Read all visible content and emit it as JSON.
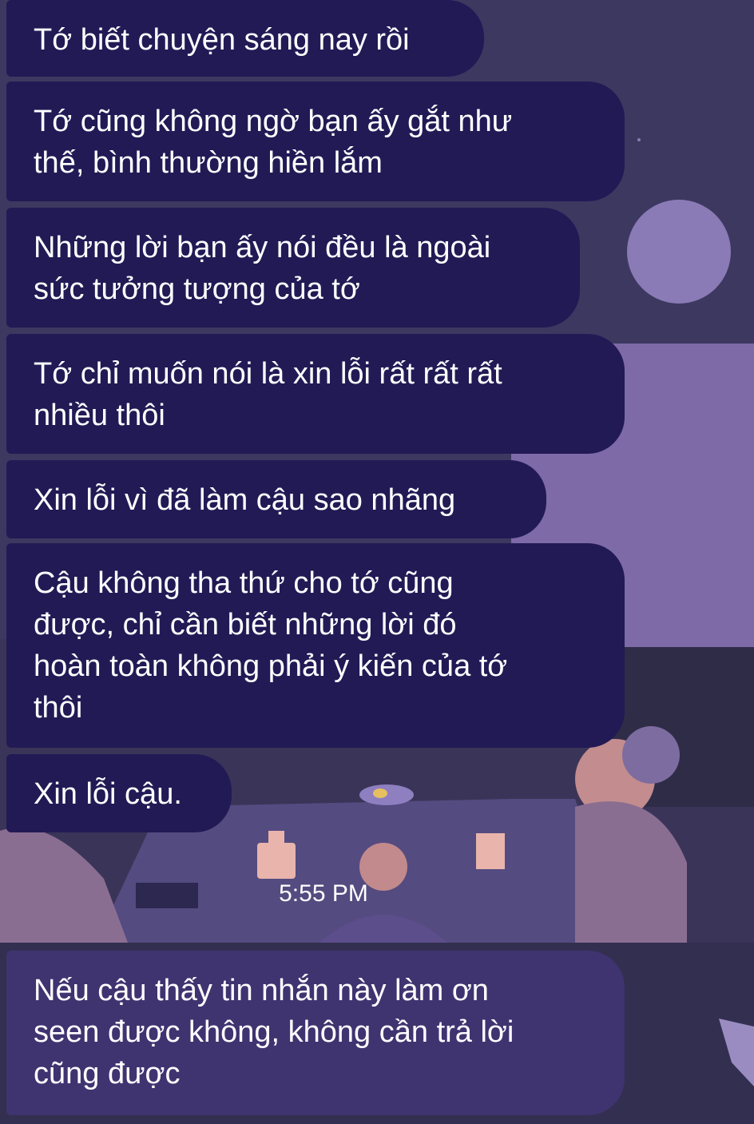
{
  "messages": [
    {
      "text": "Tớ biết chuyện sáng nay rồi"
    },
    {
      "text": "Tớ cũng không ngờ bạn ấy gắt như\nthế, bình thường hiền lắm"
    },
    {
      "text": "Những lời bạn ấy nói đều là ngoài\nsức tưởng tượng của tớ"
    },
    {
      "text": "Tớ chỉ muốn nói là xin lỗi rất rất rất\nnhiều thôi"
    },
    {
      "text": "Xin lỗi vì đã làm cậu sao nhãng"
    },
    {
      "text": "Cậu không tha thứ cho tớ cũng\nđược, chỉ cần biết những lời đó\nhoàn toàn không phải ý kiến của tớ\nthôi"
    },
    {
      "text": "Xin lỗi cậu."
    },
    {
      "text": "Nếu cậu thấy tin nhắn này làm ơn\nseen được không, không cần trả lời\ncũng được"
    }
  ],
  "timestamp": "5:55 PM",
  "colors": {
    "background": "#3a3558",
    "bubble_sent": "#221a55",
    "bubble_recent": "#3f3470"
  }
}
